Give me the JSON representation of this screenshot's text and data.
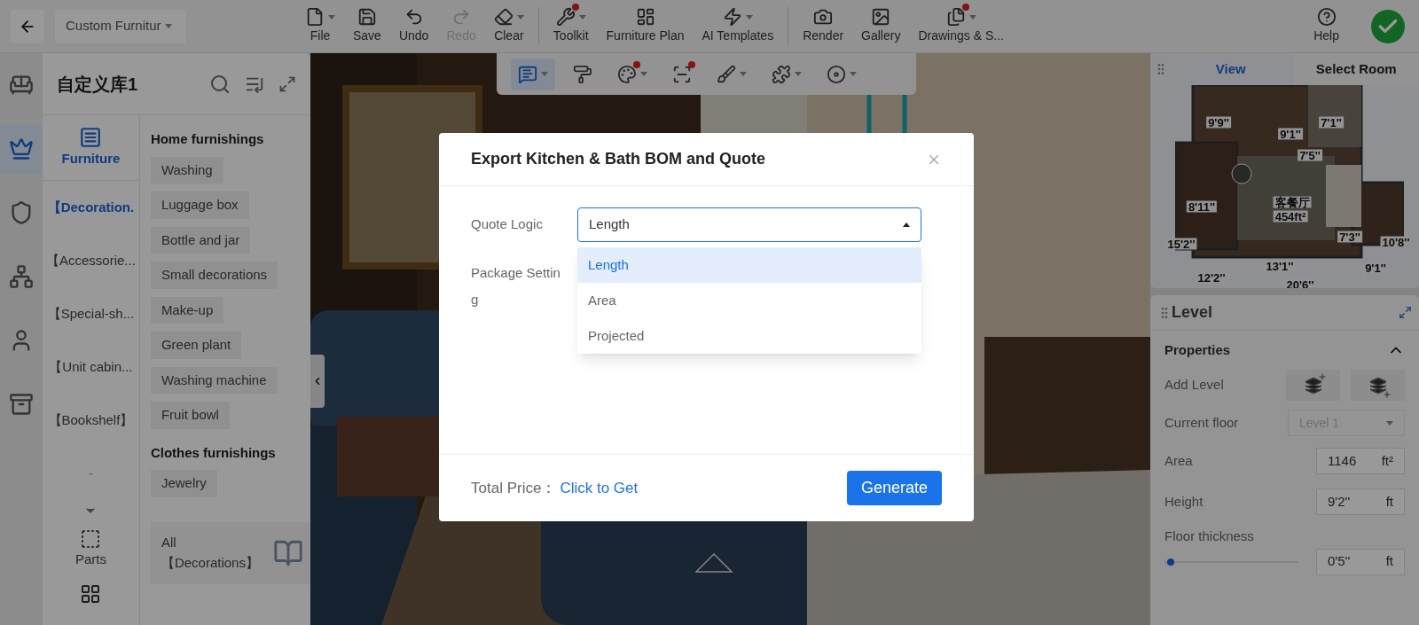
{
  "top_bar": {
    "project": "Custom Furnitur",
    "tool_groups": [
      [
        {
          "label": "File",
          "disabled": false,
          "dropdown": true,
          "badge": false
        },
        {
          "label": "Save",
          "disabled": false,
          "dropdown": false,
          "badge": false
        },
        {
          "label": "Undo",
          "disabled": false,
          "dropdown": false,
          "badge": false
        },
        {
          "label": "Redo",
          "disabled": true,
          "dropdown": false,
          "badge": false
        },
        {
          "label": "Clear",
          "disabled": false,
          "dropdown": true,
          "badge": false
        }
      ],
      [
        {
          "label": "Toolkit",
          "disabled": false,
          "dropdown": true,
          "badge": true
        },
        {
          "label": "Furniture Plan",
          "disabled": false,
          "dropdown": false,
          "badge": false
        },
        {
          "label": "AI Templates",
          "disabled": false,
          "dropdown": true,
          "badge": false
        }
      ],
      [
        {
          "label": "Render",
          "disabled": false,
          "dropdown": false,
          "badge": false
        },
        {
          "label": "Gallery",
          "disabled": false,
          "dropdown": false,
          "badge": false
        },
        {
          "label": "Drawings & S...",
          "disabled": false,
          "dropdown": true,
          "badge": true
        }
      ]
    ],
    "help": "Help"
  },
  "float_tools": [
    {
      "selected": true,
      "dropdown": true,
      "badge": false
    },
    {
      "selected": false,
      "dropdown": false,
      "badge": false
    },
    {
      "selected": false,
      "dropdown": true,
      "badge": true
    },
    {
      "selected": false,
      "dropdown": false,
      "badge": true
    },
    {
      "selected": false,
      "dropdown": true,
      "badge": false
    },
    {
      "selected": false,
      "dropdown": true,
      "badge": false
    },
    {
      "selected": false,
      "dropdown": true,
      "badge": false
    }
  ],
  "rail": [
    {
      "selected": false
    },
    {
      "selected": true
    },
    {
      "selected": false
    },
    {
      "selected": false
    },
    {
      "selected": false
    },
    {
      "selected": false
    }
  ],
  "library": {
    "title": "自定义库1",
    "tab": {
      "label": "Furniture",
      "selected": true
    },
    "categories": [
      {
        "label": "【Decoration.",
        "selected": true
      },
      {
        "label": "【Accessorie...",
        "selected": false
      },
      {
        "label": "【Special-sh...",
        "selected": false
      },
      {
        "label": "【Unit cabin...",
        "selected": false
      },
      {
        "label": "【Bookshelf】",
        "selected": false
      },
      {
        "label": "-",
        "selected": false
      }
    ],
    "parts": "Parts",
    "sections": [
      {
        "heading": "Home furnishings",
        "tags": [
          "Washing",
          "Luggage box",
          "Bottle and jar",
          "Small decorations",
          "Make-up",
          "Green plant",
          "Washing machine",
          "Fruit bowl"
        ]
      },
      {
        "heading": "Clothes furnishings",
        "tags": [
          "Jewelry"
        ]
      }
    ],
    "all_card": "All 【Decorations】"
  },
  "minimap": {
    "tabs": [
      {
        "label": "View",
        "selected": true
      },
      {
        "label": "Select Room",
        "selected": false
      }
    ],
    "plan_labels": [
      "9'9''",
      "9'1''",
      "7'1''",
      "7'5''",
      "8'11''",
      "客餐厅",
      "454ft²",
      "15'2''",
      "7'3''",
      "10'8''",
      "13'1''",
      "12'2''",
      "20'6''",
      "9'1''"
    ]
  },
  "level_panel": {
    "title": "Level",
    "section": {
      "title": "Properties",
      "expanded": true
    },
    "add_level": "Add Level",
    "current_floor": {
      "label": "Current floor",
      "value": "Level 1",
      "disabled": true
    },
    "fields": [
      {
        "label": "Area",
        "value": "1146",
        "unit": "ft²"
      },
      {
        "label": "Height",
        "value": "9'2''",
        "unit": "ft"
      }
    ],
    "thickness": {
      "label": "Floor thickness",
      "level": 0.02,
      "value": "0'5''",
      "unit": "ft"
    }
  },
  "modal": {
    "title": "Export Kitchen & Bath BOM and Quote",
    "fields": [
      {
        "kind": "select",
        "label": "Quote Logic",
        "value": "Length",
        "expanded": true,
        "options": [
          {
            "label": "Length",
            "selected": true
          },
          {
            "label": "Area",
            "selected": false
          },
          {
            "label": "Projected",
            "selected": false
          }
        ]
      },
      {
        "kind": "empty",
        "label": "Package Setting"
      }
    ],
    "total_label": "Total Price：",
    "total_link": "Click to Get",
    "generate": "Generate"
  }
}
